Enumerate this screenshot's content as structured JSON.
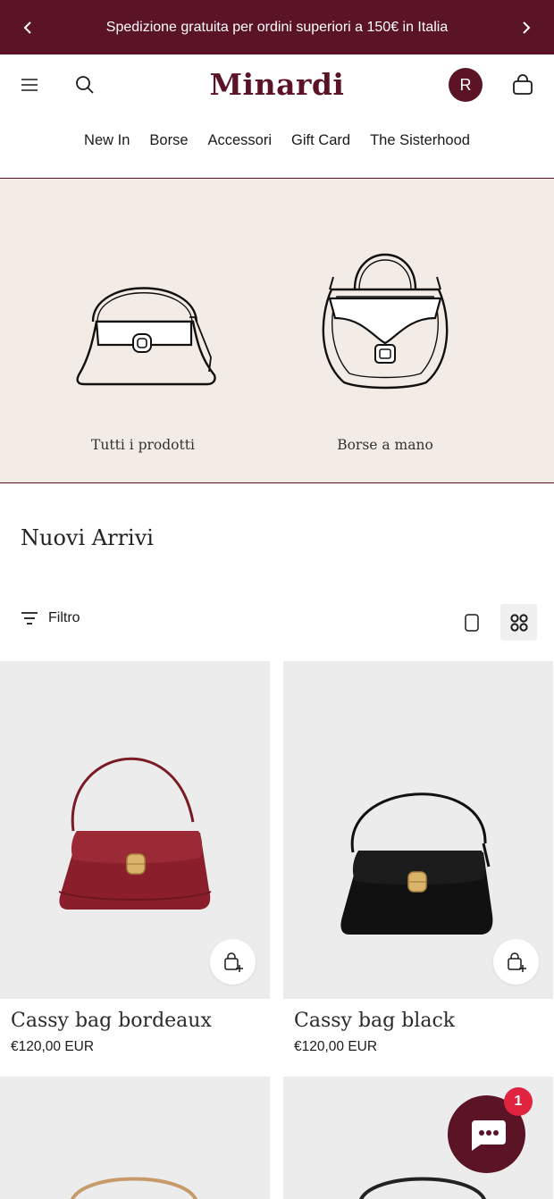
{
  "announcement": {
    "text": "Spedizione gratuita per ordini superiori a 150€ in Italia"
  },
  "header": {
    "logo": "Minardi",
    "avatar_initial": "R"
  },
  "nav": {
    "items": [
      "New In",
      "Borse",
      "Accessori",
      "Gift Card",
      "The Sisterhood"
    ]
  },
  "categories": [
    {
      "label": "Tutti i prodotti",
      "icon": "shoulder-bag-outline"
    },
    {
      "label": "Borse a mano",
      "icon": "handbag-outline"
    }
  ],
  "section": {
    "title": "Nuovi Arrivi"
  },
  "filter": {
    "label": "Filtro"
  },
  "products": [
    {
      "name": "Cassy bag bordeaux",
      "price": "€120,00 EUR",
      "color": "#8a1f2b"
    },
    {
      "name": "Cassy bag black",
      "price": "€120,00 EUR",
      "color": "#111111"
    }
  ],
  "chat": {
    "badge_count": "1"
  },
  "colors": {
    "brand": "#5b1425",
    "hero_bg": "#f2ebe6",
    "badge": "#e0233f"
  }
}
